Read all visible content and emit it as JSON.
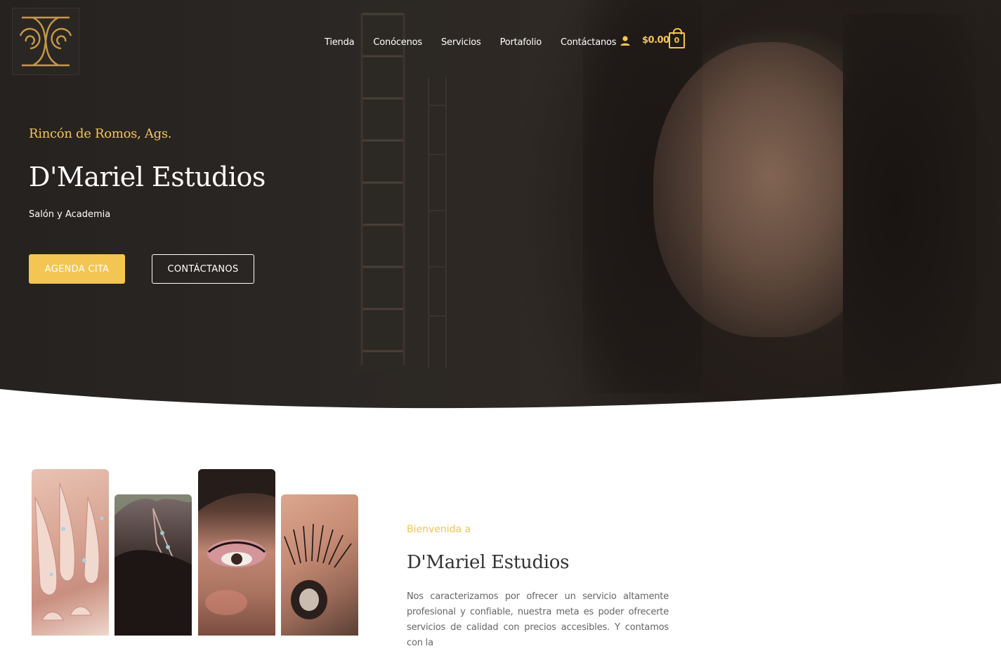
{
  "brand": {
    "logo_name": "dmariel-logo",
    "accent": "#f3c552"
  },
  "nav": {
    "items": [
      {
        "label": "Tienda"
      },
      {
        "label": "Conócenos"
      },
      {
        "label": "Servicios"
      },
      {
        "label": "Portafolio"
      },
      {
        "label": "Contáctanos"
      }
    ],
    "account_icon": "user-icon",
    "cart_total": "$0.00",
    "cart_count": "0"
  },
  "hero": {
    "location": "Rincón de Romos, Ags.",
    "title": "D'Mariel Estudios",
    "subtitle": "Salón y Academia",
    "primary_button": "AGENDA CITA",
    "secondary_button": "CONTÁCTANOS",
    "background": "#2a2522"
  },
  "gallery": {
    "images": [
      "nails-image",
      "hair-tiara-image",
      "makeup-eye-image",
      "eyelash-extension-image"
    ]
  },
  "welcome": {
    "kicker": "Bienvenida a",
    "title": "D'Mariel Estudios",
    "body": "Nos caracterizamos por ofrecer un servicio altamente profesional y confiable, nuestra meta es poder ofrecerte servicios de calidad con precios accesibles. Y contamos con la"
  }
}
